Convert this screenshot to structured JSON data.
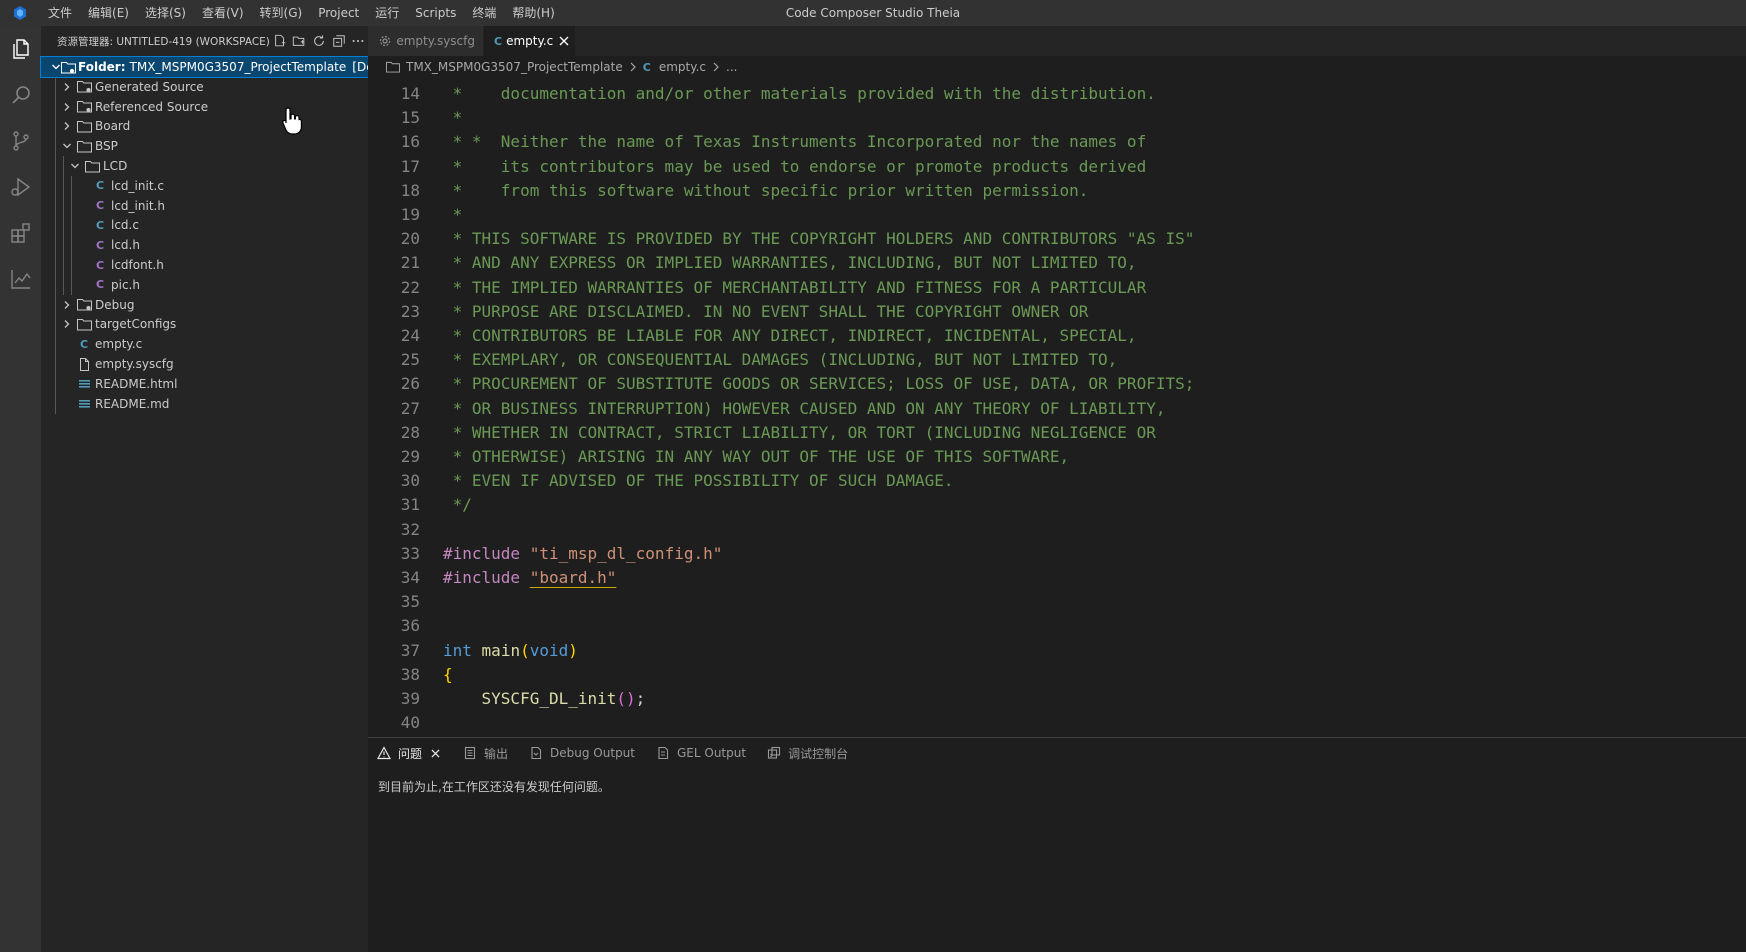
{
  "titlebar": {
    "window_title": "Code Composer Studio Theia",
    "menu": [
      "文件",
      "编辑(E)",
      "选择(S)",
      "查看(V)",
      "转到(G)",
      "Project",
      "运行",
      "Scripts",
      "终端",
      "帮助(H)"
    ]
  },
  "activity_bar": {
    "items": [
      "files-icon",
      "search-icon",
      "source-control-icon",
      "run-debug-icon",
      "extensions-icon",
      "chart-icon"
    ]
  },
  "explorer": {
    "title": "资源管理器: UNTITLED-419 (WORKSPACE)",
    "root": {
      "prefix": "Folder:",
      "name": "TMX_MSPM0G3507_ProjectTemplate",
      "desc": "[De..."
    },
    "items": [
      {
        "label": "Generated Source",
        "kind": "folder-linked",
        "depth": 1,
        "expanded": false
      },
      {
        "label": "Referenced Source",
        "kind": "folder-linked",
        "depth": 1,
        "expanded": false
      },
      {
        "label": "Board",
        "kind": "folder",
        "depth": 1,
        "expanded": false
      },
      {
        "label": "BSP",
        "kind": "folder",
        "depth": 1,
        "expanded": true
      },
      {
        "label": "LCD",
        "kind": "folder",
        "depth": 2,
        "expanded": true
      },
      {
        "label": "lcd_init.c",
        "kind": "c",
        "depth": 3
      },
      {
        "label": "lcd_init.h",
        "kind": "h",
        "depth": 3
      },
      {
        "label": "lcd.c",
        "kind": "c",
        "depth": 3
      },
      {
        "label": "lcd.h",
        "kind": "h",
        "depth": 3
      },
      {
        "label": "lcdfont.h",
        "kind": "h",
        "depth": 3
      },
      {
        "label": "pic.h",
        "kind": "h",
        "depth": 3
      },
      {
        "label": "Debug",
        "kind": "folder-linked",
        "depth": 1,
        "expanded": false
      },
      {
        "label": "targetConfigs",
        "kind": "folder",
        "depth": 1,
        "expanded": false
      },
      {
        "label": "empty.c",
        "kind": "c",
        "depth": 1
      },
      {
        "label": "empty.syscfg",
        "kind": "file",
        "depth": 1
      },
      {
        "label": "README.html",
        "kind": "doc",
        "depth": 1
      },
      {
        "label": "README.md",
        "kind": "doc",
        "depth": 1
      }
    ]
  },
  "tabs": [
    {
      "label": "empty.syscfg",
      "icon": "gear-icon",
      "active": false
    },
    {
      "label": "empty.c",
      "icon": "c-file-icon",
      "active": true
    }
  ],
  "breadcrumbs": [
    "TMX_MSPM0G3507_ProjectTemplate",
    "empty.c",
    "..."
  ],
  "editor": {
    "lines": [
      {
        "n": "14",
        "tokens": [
          [
            "comment",
            " *    documentation and/or other materials provided with the distribution."
          ]
        ]
      },
      {
        "n": "15",
        "tokens": [
          [
            "comment",
            " *"
          ]
        ]
      },
      {
        "n": "16",
        "tokens": [
          [
            "comment",
            " * *  Neither the name of Texas Instruments Incorporated nor the names of"
          ]
        ]
      },
      {
        "n": "17",
        "tokens": [
          [
            "comment",
            " *    its contributors may be used to endorse or promote products derived"
          ]
        ]
      },
      {
        "n": "18",
        "tokens": [
          [
            "comment",
            " *    from this software without specific prior written permission."
          ]
        ]
      },
      {
        "n": "19",
        "tokens": [
          [
            "comment",
            " *"
          ]
        ]
      },
      {
        "n": "20",
        "tokens": [
          [
            "comment",
            " * THIS SOFTWARE IS PROVIDED BY THE COPYRIGHT HOLDERS AND CONTRIBUTORS \"AS IS\""
          ]
        ]
      },
      {
        "n": "21",
        "tokens": [
          [
            "comment",
            " * AND ANY EXPRESS OR IMPLIED WARRANTIES, INCLUDING, BUT NOT LIMITED TO,"
          ]
        ]
      },
      {
        "n": "22",
        "tokens": [
          [
            "comment",
            " * THE IMPLIED WARRANTIES OF MERCHANTABILITY AND FITNESS FOR A PARTICULAR"
          ]
        ]
      },
      {
        "n": "23",
        "tokens": [
          [
            "comment",
            " * PURPOSE ARE DISCLAIMED. IN NO EVENT SHALL THE COPYRIGHT OWNER OR"
          ]
        ]
      },
      {
        "n": "24",
        "tokens": [
          [
            "comment",
            " * CONTRIBUTORS BE LIABLE FOR ANY DIRECT, INDIRECT, INCIDENTAL, SPECIAL,"
          ]
        ]
      },
      {
        "n": "25",
        "tokens": [
          [
            "comment",
            " * EXEMPLARY, OR CONSEQUENTIAL DAMAGES (INCLUDING, BUT NOT LIMITED TO,"
          ]
        ]
      },
      {
        "n": "26",
        "tokens": [
          [
            "comment",
            " * PROCUREMENT OF SUBSTITUTE GOODS OR SERVICES; LOSS OF USE, DATA, OR PROFITS;"
          ]
        ]
      },
      {
        "n": "27",
        "tokens": [
          [
            "comment",
            " * OR BUSINESS INTERRUPTION) HOWEVER CAUSED AND ON ANY THEORY OF LIABILITY,"
          ]
        ]
      },
      {
        "n": "28",
        "tokens": [
          [
            "comment",
            " * WHETHER IN CONTRACT, STRICT LIABILITY, OR TORT (INCLUDING NEGLIGENCE OR"
          ]
        ]
      },
      {
        "n": "29",
        "tokens": [
          [
            "comment",
            " * OTHERWISE) ARISING IN ANY WAY OUT OF THE USE OF THIS SOFTWARE,"
          ]
        ]
      },
      {
        "n": "30",
        "tokens": [
          [
            "comment",
            " * EVEN IF ADVISED OF THE POSSIBILITY OF SUCH DAMAGE."
          ]
        ]
      },
      {
        "n": "31",
        "tokens": [
          [
            "comment",
            " */"
          ]
        ]
      },
      {
        "n": "32",
        "tokens": []
      },
      {
        "n": "33",
        "tokens": [
          [
            "pre",
            "#include "
          ],
          [
            "str",
            "\"ti_msp_dl_config.h\""
          ]
        ]
      },
      {
        "n": "34",
        "tokens": [
          [
            "pre",
            "#include "
          ],
          [
            "str warn",
            "\"board.h\""
          ]
        ]
      },
      {
        "n": "35",
        "tokens": []
      },
      {
        "n": "36",
        "tokens": []
      },
      {
        "n": "37",
        "tokens": [
          [
            "kw",
            "int"
          ],
          [
            "pun",
            " "
          ],
          [
            "fn",
            "main"
          ],
          [
            "b1",
            "("
          ],
          [
            "kw",
            "void"
          ],
          [
            "b1",
            ")"
          ]
        ]
      },
      {
        "n": "38",
        "tokens": [
          [
            "b1",
            "{"
          ]
        ]
      },
      {
        "n": "39",
        "tokens": [
          [
            "pun",
            "    "
          ],
          [
            "fn",
            "SYSCFG_DL_init"
          ],
          [
            "b2",
            "()"
          ],
          [
            "pun",
            ";"
          ]
        ]
      },
      {
        "n": "40",
        "tokens": []
      }
    ]
  },
  "panel": {
    "tabs": [
      {
        "label": "问题",
        "icon": "warning-icon",
        "active": true,
        "closable": true
      },
      {
        "label": "输出",
        "icon": "output-icon",
        "active": false
      },
      {
        "label": "Debug Output",
        "icon": "debug-output-icon",
        "active": false
      },
      {
        "label": "GEL Output",
        "icon": "gel-output-icon",
        "active": false
      },
      {
        "label": "调试控制台",
        "icon": "debug-console-icon",
        "active": false
      }
    ],
    "message": "到目前为止,在工作区还没有发现任何问题。"
  },
  "colors": {
    "accent": "#007fd4",
    "selection": "#094771",
    "c_icon": "#519aba",
    "h_icon": "#a074c4"
  }
}
